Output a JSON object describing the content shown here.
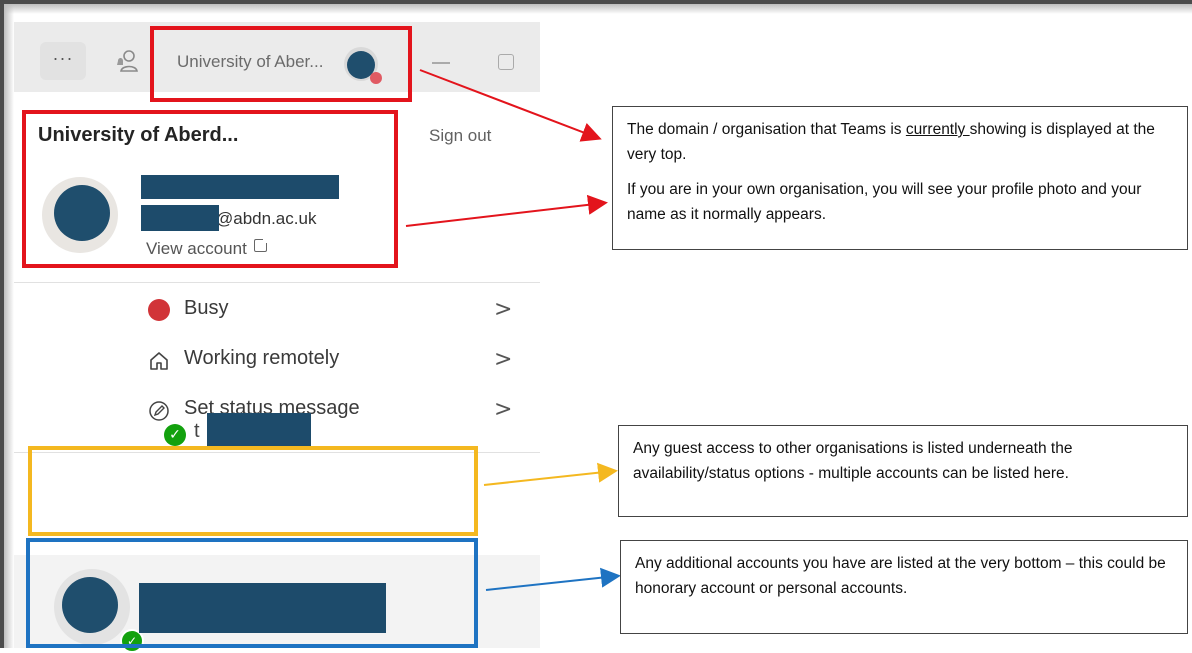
{
  "titlebar": {
    "more_label": "···",
    "org_short": "University of Aber..."
  },
  "panel": {
    "org_name": "University of Aberd...",
    "sign_out": "Sign out",
    "email_suffix": "abdn.ac.uk",
    "view_account": "View account",
    "status_items": [
      {
        "label": "Busy",
        "icon": "busy-dot"
      },
      {
        "label": "Working remotely",
        "icon": "home-icon"
      },
      {
        "label": "Set status message",
        "icon": "pencil-circle-icon"
      }
    ],
    "guest_letter": "t"
  },
  "annotations": {
    "note1_line1_a": "The domain / organisation that Teams is ",
    "note1_line1_u": "currently ",
    "note1_line1_b": "showing is displayed at the very top.",
    "note1_para2": "If you are in your own organisation, you will see your profile photo and your name as it normally appears.",
    "note2": "Any guest access to other organisations is listed underneath the availability/status options - multiple accounts can be listed here.",
    "note3": "Any additional accounts you have are listed at the very bottom – this could be honorary account or personal accounts."
  },
  "colors": {
    "red_highlight": "#e3141c",
    "yellow_highlight": "#f4b820",
    "blue_highlight": "#1e73c2",
    "busy": "#d13438",
    "available": "#13a10e",
    "redaction": "#1d4b6b"
  }
}
